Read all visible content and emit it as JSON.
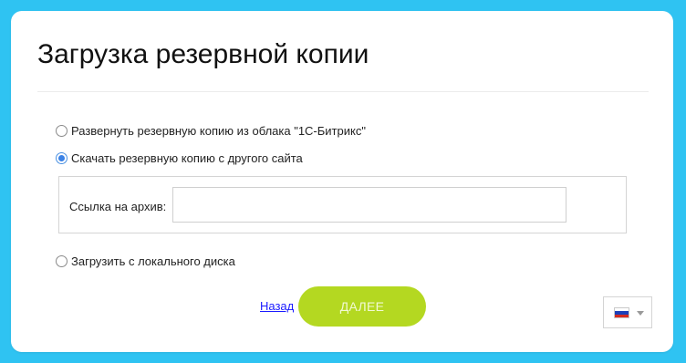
{
  "page": {
    "title": "Загрузка резервной копии"
  },
  "options": {
    "cloud_label": "Развернуть резервную копию из облака \"1С-Битрикс\"",
    "remote_label": "Скачать резервную копию с другого сайта",
    "local_label": "Загрузить с локального диска",
    "selected": "remote"
  },
  "archive": {
    "label": "Ссылка на архив:",
    "value": "",
    "placeholder": ""
  },
  "actions": {
    "back_label": "Назад",
    "next_label": "ДАЛЕЕ"
  },
  "language": {
    "selected_icon": "russian-flag-icon"
  },
  "colors": {
    "background": "#2fc3f2",
    "accent_button": "#b4d821",
    "radio_checked": "#3b82e6",
    "link": "#1a1aff"
  }
}
